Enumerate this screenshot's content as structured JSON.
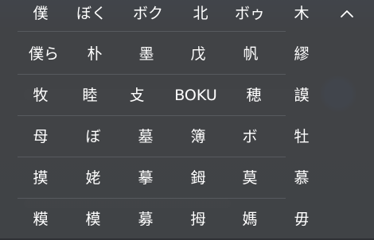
{
  "top_candidates": [
    "僕",
    "ぼく",
    "ボク",
    "北",
    "ボゥ",
    "木"
  ],
  "collapse_icon": "chevron-up-icon",
  "grid": [
    [
      "僕ら",
      "朴",
      "墨",
      "戊",
      "帆",
      "繆"
    ],
    [
      "牧",
      "睦",
      "攴",
      "BOKU",
      "穂",
      "謨"
    ],
    [
      "母",
      "ぼ",
      "墓",
      "簿",
      "ボ",
      "牡"
    ],
    [
      "摸",
      "姥",
      "摹",
      "鉧",
      "莫",
      "慕"
    ],
    [
      "糢",
      "模",
      "募",
      "拇",
      "媽",
      "毋"
    ]
  ],
  "colors": {
    "panel": "#424448",
    "text": "#ffffff",
    "divider": "#575a5f"
  }
}
